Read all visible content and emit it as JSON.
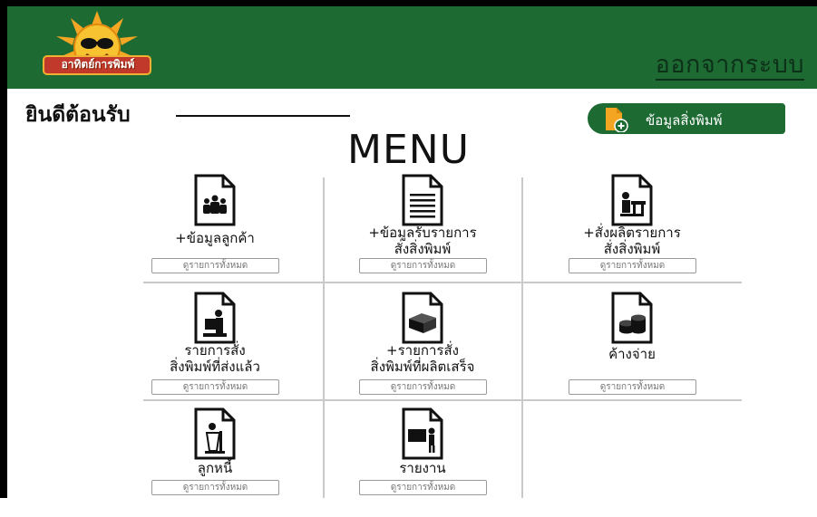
{
  "header": {
    "logo_text": "อาทิตย์การพิมพ์",
    "logout_label": "ออกจากระบบ"
  },
  "welcome": {
    "label": "ยินดีต้อนรับ"
  },
  "print_info_button": {
    "label": "ข้อมูลสิ่งพิมพ์"
  },
  "menu": {
    "title": "MENU",
    "items": [
      {
        "title": "+ข้อมูลลูกค้า",
        "view_all": "ดูรายการทั้งหมด",
        "icon": "customers-icon"
      },
      {
        "title": "+ข้อมูลรับรายการ\nสั่งสิ่งพิมพ์",
        "view_all": "ดูรายการทั้งหมด",
        "icon": "document-lines-icon"
      },
      {
        "title": "+สั่งผลิตรายการ\nสั่งสิ่งพิมพ์",
        "view_all": "ดูรายการทั้งหมด",
        "icon": "production-icon"
      },
      {
        "title": "รายการสั่ง\nสิ่งพิมพ์ที่ส่งแล้ว",
        "view_all": "ดูรายการทั้งหมด",
        "icon": "delivery-icon"
      },
      {
        "title": "+รายการสั่ง\nสิ่งพิมพ์ที่ผลิตเสร็จ",
        "view_all": "ดูรายการทั้งหมด",
        "icon": "box-icon"
      },
      {
        "title": "ค้างจ่าย",
        "view_all": "ดูรายการทั้งหมด",
        "icon": "coins-icon"
      },
      {
        "title": "ลูกหนี้",
        "view_all": "ดูรายการทั้งหมด",
        "icon": "debtor-icon"
      },
      {
        "title": "รายงาน",
        "view_all": "ดูรายการทั้งหมด",
        "icon": "report-icon"
      }
    ]
  },
  "colors": {
    "header_bg": "#1e6a33",
    "accent": "#1e6a33",
    "document_icon": "#f4a623"
  }
}
